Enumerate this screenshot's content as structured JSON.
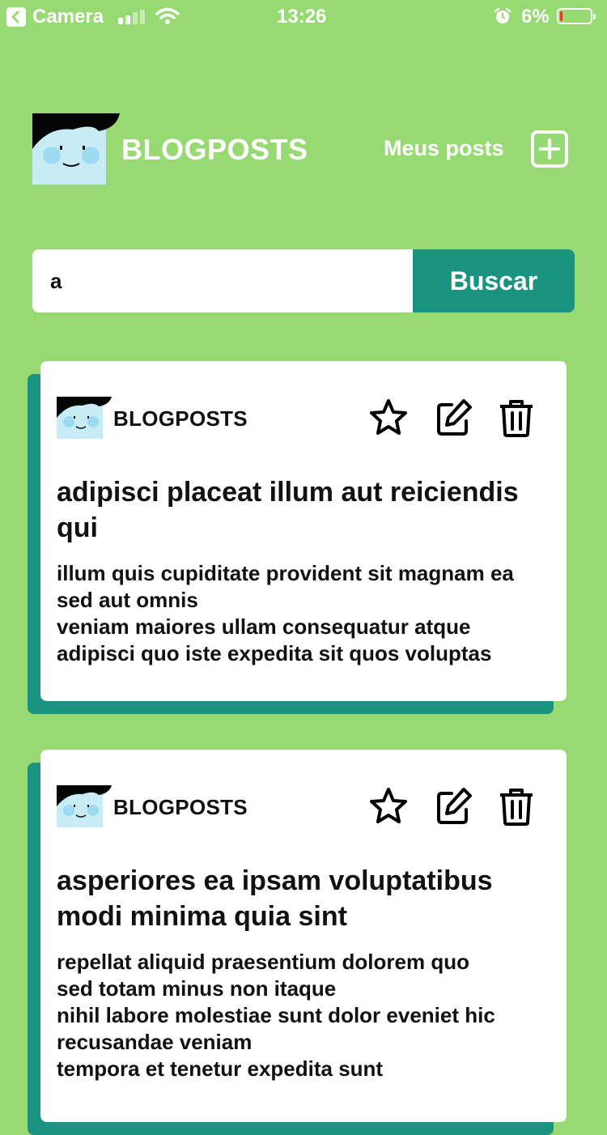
{
  "status_bar": {
    "back_label": "Camera",
    "time": "13:26",
    "battery_percent": "6%",
    "battery_level": 0.06,
    "battery_color": "#e53c2a"
  },
  "header": {
    "logo_icon": "avatar-face-icon",
    "title": "BLOGPOSTS",
    "my_posts_label": "Meus posts",
    "add_icon": "plus-square-icon"
  },
  "search": {
    "value": "a",
    "button_label": "Buscar"
  },
  "colors": {
    "background": "#97d973",
    "accent": "#1a9480",
    "card": "#ffffff",
    "text": "#111111"
  },
  "posts": [
    {
      "author": "BLOGPOSTS",
      "title": "adipisci placeat illum aut reiciendis qui",
      "body": "illum quis cupiditate provident sit magnam ea sed aut omnis\nveniam maiores ullam consequatur atque adipisci quo iste expedita sit quos voluptas",
      "actions": [
        "star-icon",
        "edit-icon",
        "trash-icon"
      ]
    },
    {
      "author": "BLOGPOSTS",
      "title": "asperiores ea ipsam voluptatibus modi minima quia sint",
      "body": "repellat aliquid praesentium dolorem quo\nsed totam minus non itaque\nnihil labore molestiae sunt dolor eveniet hic recusandae veniam\ntempora et tenetur expedita sunt",
      "actions": [
        "star-icon",
        "edit-icon",
        "trash-icon"
      ]
    }
  ]
}
